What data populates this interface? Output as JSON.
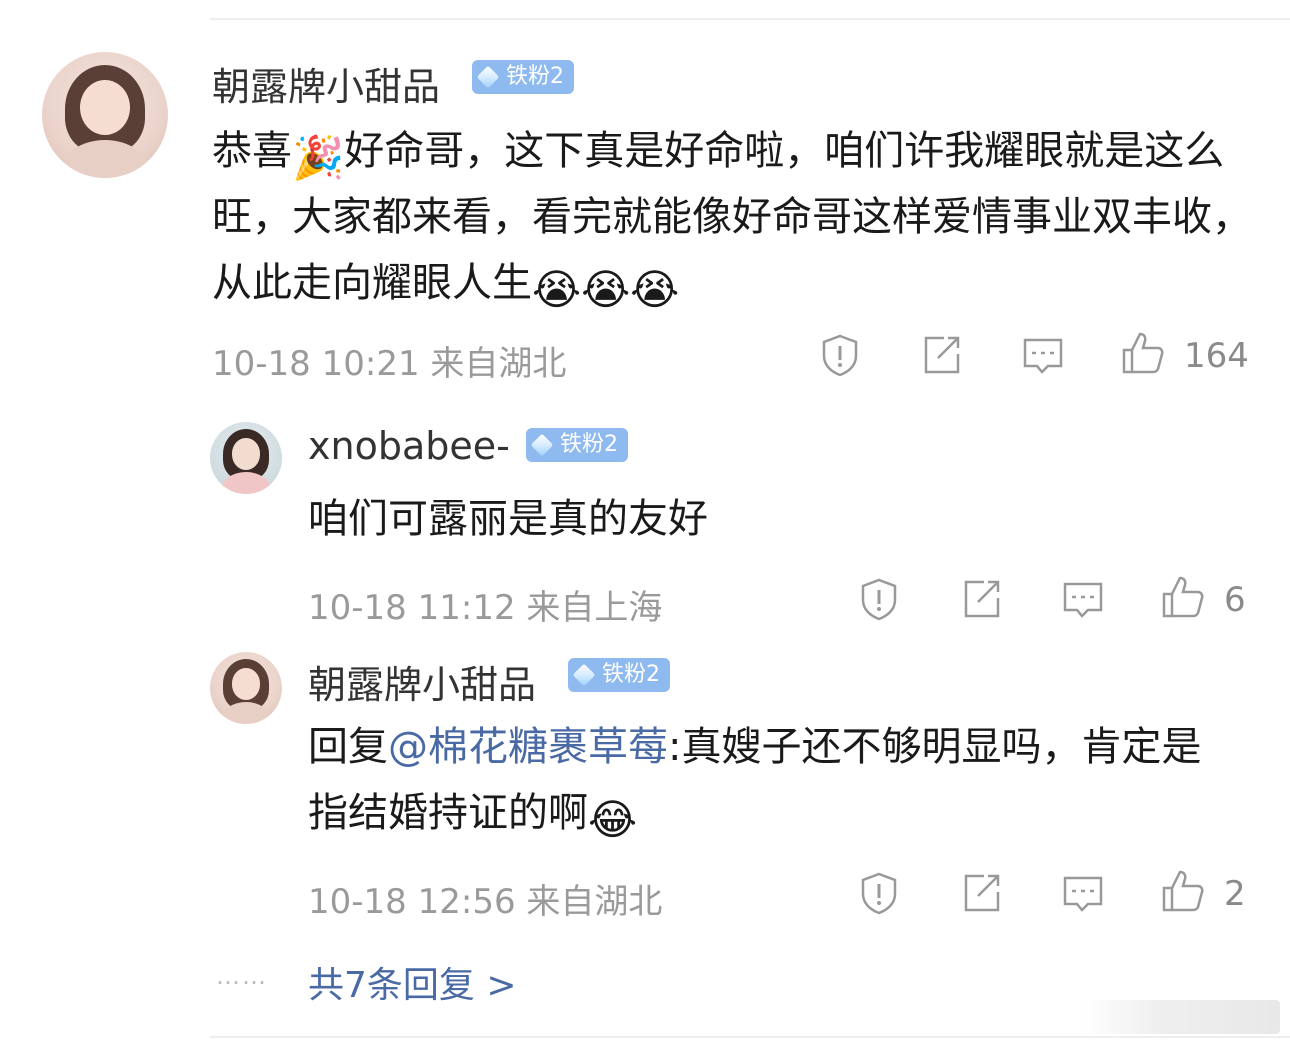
{
  "comments": [
    {
      "username": "朝露牌小甜品",
      "badge": "铁粉2",
      "text_parts": [
        "恭喜",
        "好命哥，这下真是好命啦，咱们许我耀眼就是这么旺，大家都来看，看完就能像好命哥这样爱情事业双丰收，从此走向耀眼人生"
      ],
      "emoji_party": "🎉",
      "emoji_cry": "😭",
      "time": "10-18 10:21",
      "location": "来自湖北",
      "likes": "164"
    },
    {
      "username": "xnobabee-",
      "badge": "铁粉2",
      "text": "咱们可露丽是真的友好",
      "time": "10-18 11:12",
      "location": "来自上海",
      "likes": "6"
    },
    {
      "username": "朝露牌小甜品",
      "badge": "铁粉2",
      "reply_prefix": "回复",
      "mention": "@棉花糖裹草莓",
      "text": ":真嫂子还不够明显吗，肯定是指结婚持证的啊",
      "emoji_laugh": "😂",
      "time": "10-18 12:56",
      "location": "来自湖北",
      "likes": "2"
    }
  ],
  "footer": {
    "dots": "……",
    "more_replies": "共7条回复 >"
  },
  "icons": [
    "report-icon",
    "share-icon",
    "comment-icon",
    "like-icon"
  ]
}
